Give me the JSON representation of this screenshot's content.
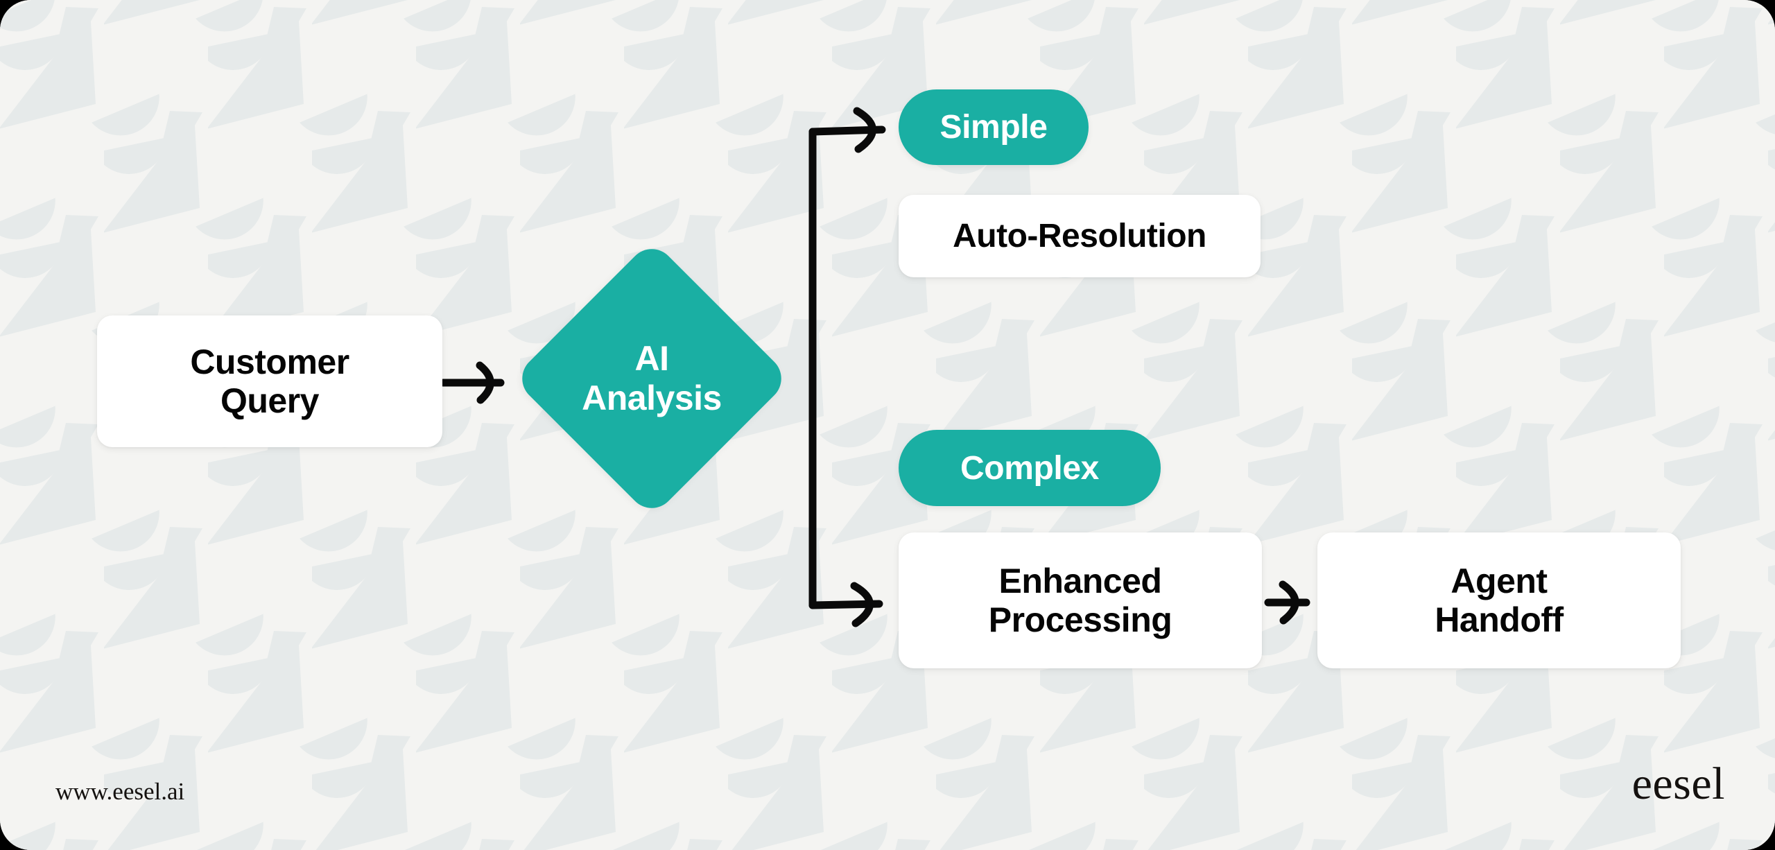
{
  "canvas": {
    "background_color": "#F4F4F2",
    "pattern_color": "#E6EAEA",
    "accent_color": "#1AAFA3",
    "card_color": "#FFFFFF",
    "text_color": "#050505",
    "connector_color": "#0A0A0A"
  },
  "diagram": {
    "type": "flowchart",
    "nodes": [
      {
        "id": "customer-query",
        "label": "Customer\nQuery",
        "shape": "rounded-rect",
        "style": "white-card"
      },
      {
        "id": "ai-analysis",
        "label": "AI\nAnalysis",
        "shape": "diamond",
        "style": "teal-fill"
      },
      {
        "id": "simple",
        "label": "Simple",
        "shape": "pill",
        "style": "teal-fill"
      },
      {
        "id": "auto-resolution",
        "label": "Auto-Resolution",
        "shape": "rounded-rect",
        "style": "white-card"
      },
      {
        "id": "complex",
        "label": "Complex",
        "shape": "pill",
        "style": "teal-fill"
      },
      {
        "id": "enhanced-processing",
        "label": "Enhanced\nProcessing",
        "shape": "rounded-rect",
        "style": "white-card"
      },
      {
        "id": "agent-handoff",
        "label": "Agent\nHandoff",
        "shape": "rounded-rect",
        "style": "white-card"
      }
    ],
    "edges": [
      {
        "from": "customer-query",
        "to": "ai-analysis",
        "style": "straight-arrow"
      },
      {
        "from": "ai-analysis",
        "to": "simple",
        "style": "branch-arrow-up"
      },
      {
        "from": "ai-analysis",
        "to": "enhanced-processing",
        "style": "branch-arrow-down"
      },
      {
        "from": "enhanced-processing",
        "to": "agent-handoff",
        "style": "straight-arrow"
      }
    ]
  },
  "footer": {
    "url": "www.eesel.ai",
    "brand": "eesel"
  }
}
